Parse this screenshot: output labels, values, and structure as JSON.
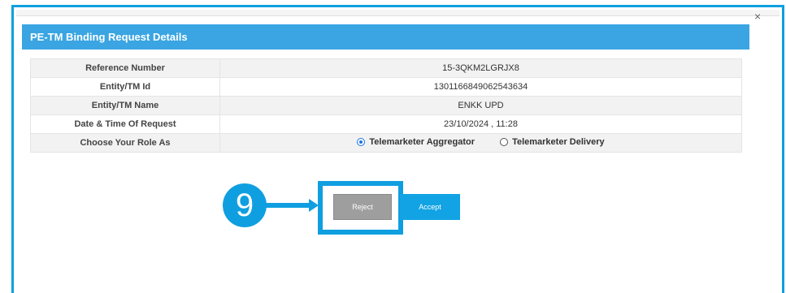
{
  "modal": {
    "title": "PE-TM Binding Request Details",
    "close_symbol": "×"
  },
  "details": {
    "rows": [
      {
        "label": "Reference Number",
        "value": "15-3QKM2LGRJX8"
      },
      {
        "label": "Entity/TM Id",
        "value": "1301166849062543634"
      },
      {
        "label": "Entity/TM Name",
        "value": "ENKK UPD"
      },
      {
        "label": "Date & Time Of Request",
        "value": "23/10/2024 , 11:28"
      }
    ],
    "role_label": "Choose Your Role As",
    "role_options": [
      {
        "label": "Telemarketer Aggregator",
        "selected": true
      },
      {
        "label": "Telemarketer Delivery",
        "selected": false
      }
    ]
  },
  "actions": {
    "reject_label": "Reject",
    "accept_label": "Accept"
  },
  "annotation": {
    "step_number": "9"
  },
  "colors": {
    "accent": "#0f9fe0",
    "header": "#3aa5e2",
    "reject_button": "#9e9e9e",
    "accept_button": "#11a3e4"
  }
}
